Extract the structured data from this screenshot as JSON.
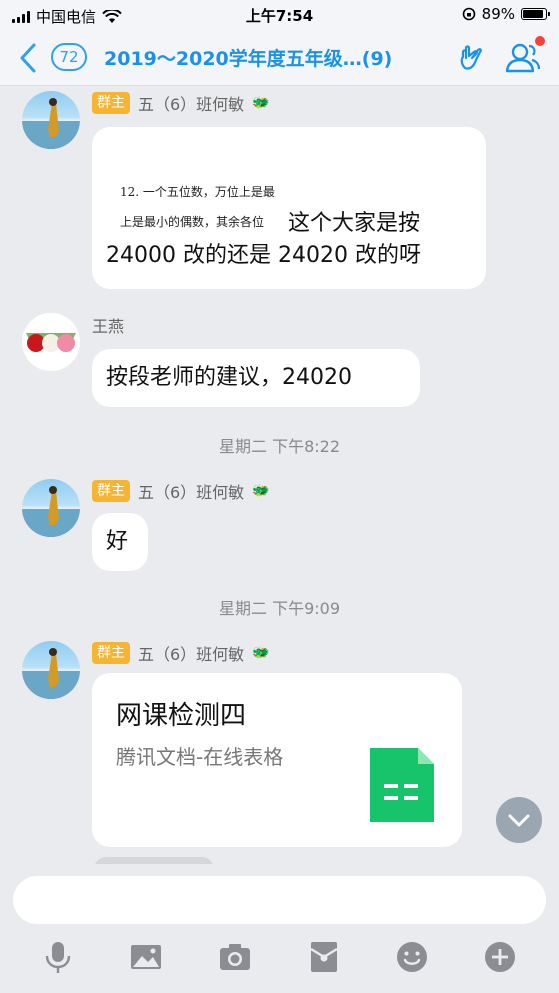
{
  "status_bar": {
    "carrier": "中国电信",
    "time": "上午7:54",
    "battery": "89%",
    "battery_level": 0.89
  },
  "nav": {
    "unread_count": "72",
    "title": "2019～2020学年度五年级…",
    "member_count": "(9)",
    "accent_color": "#1b92e8"
  },
  "messages": [
    {
      "sender": "五（6）班何敏",
      "owner_badge": "群主",
      "quote_lines": [
        "12. 一个五位数，万位上是最",
        "上是最小的偶数，其余各位"
      ],
      "line1": "这个大家是按",
      "line2": "24000 改的还是 24020 改的呀"
    },
    {
      "sender": "王燕",
      "text": "按段老师的建议，24020"
    },
    {
      "separator": "星期二 下午8:22"
    },
    {
      "sender": "五（6）班何敏",
      "owner_badge": "群主",
      "text": "好"
    },
    {
      "separator": "星期二 下午9:09"
    },
    {
      "sender": "五（6）班何敏",
      "owner_badge": "群主",
      "doc_title": "网课检测四",
      "doc_subtitle": "腾讯文档-在线表格"
    }
  ],
  "input": {
    "placeholder": ""
  },
  "toolbar": {
    "icons": [
      "microphone-icon",
      "image-icon",
      "camera-icon",
      "red-packet-icon",
      "emoji-icon",
      "plus-icon"
    ]
  }
}
